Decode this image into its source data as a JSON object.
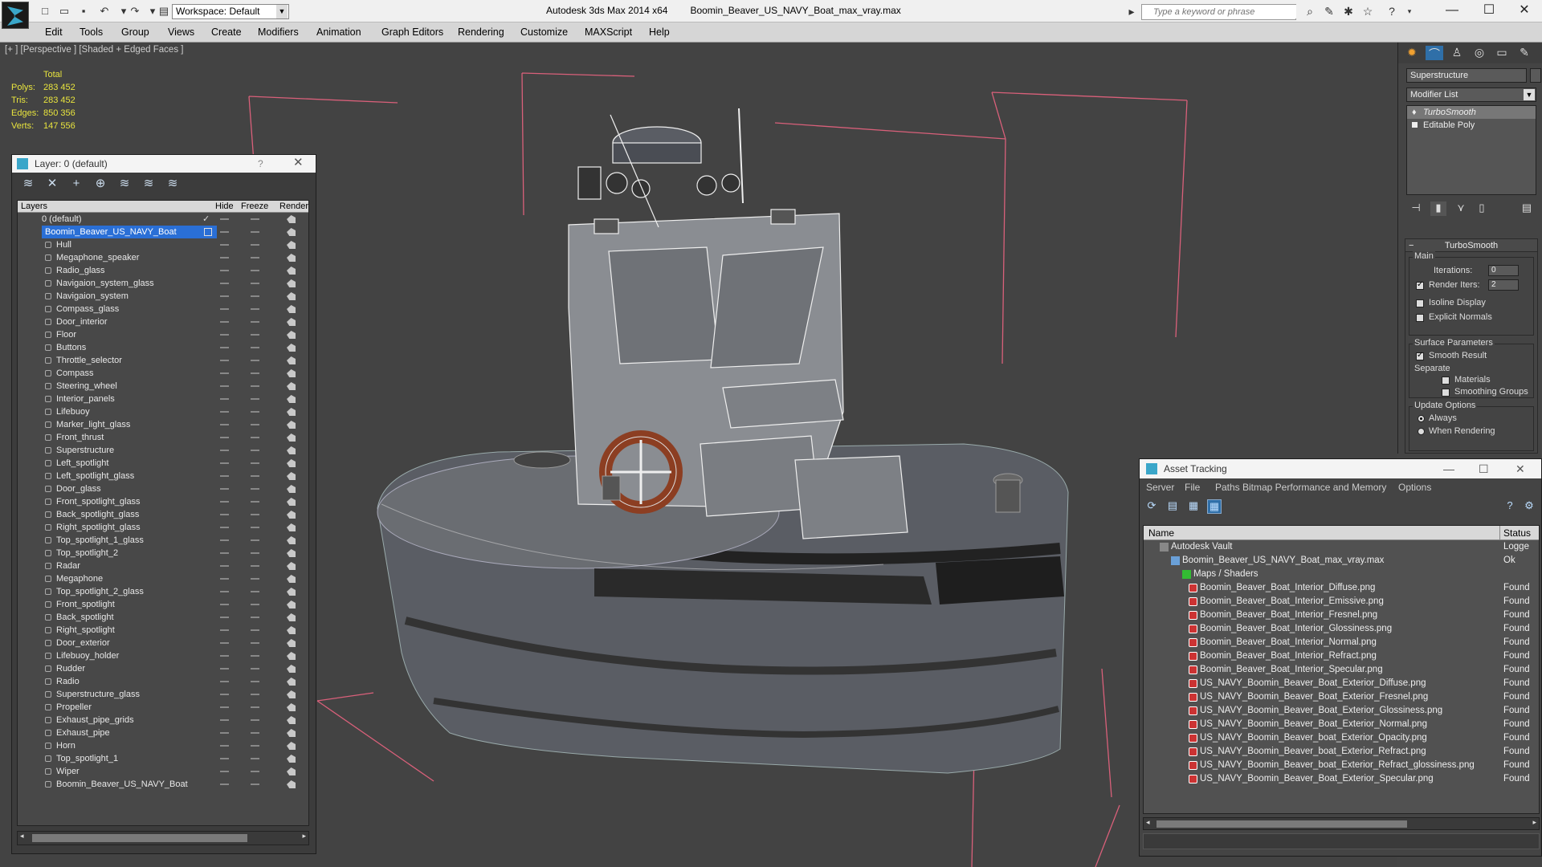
{
  "titlebar": {
    "workspace_label": "Workspace: Default",
    "app_name": "Autodesk 3ds Max  2014 x64",
    "file_name": "Boomin_Beaver_US_NAVY_Boat_max_vray.max",
    "search_placeholder": "Type a keyword or phrase"
  },
  "menu": [
    "Edit",
    "Tools",
    "Group",
    "Views",
    "Create",
    "Modifiers",
    "Animation",
    "Graph Editors",
    "Rendering",
    "Customize",
    "MAXScript",
    "Help"
  ],
  "viewport": {
    "label": "[+ ] [Perspective ] [Shaded + Edged Faces ]",
    "stats_header": "Total",
    "stats": [
      {
        "k": "Polys:",
        "v": "283 452"
      },
      {
        "k": "Tris:",
        "v": "283 452"
      },
      {
        "k": "Edges:",
        "v": "850 356"
      },
      {
        "k": "Verts:",
        "v": "147 556"
      }
    ]
  },
  "layer_panel": {
    "title": "Layer: 0 (default)",
    "help": "?",
    "col_layers": "Layers",
    "col_hide": "Hide",
    "col_freeze": "Freeze",
    "col_render": "Render",
    "default_layer": "0 (default)",
    "boat_layer": "Boomin_Beaver_US_NAVY_Boat",
    "objects": [
      "Hull",
      "Megaphone_speaker",
      "Radio_glass",
      "Navigaion_system_glass",
      "Navigaion_system",
      "Compass_glass",
      "Door_interior",
      "Floor",
      "Buttons",
      "Throttle_selector",
      "Compass",
      "Steering_wheel",
      "Interior_panels",
      "Lifebuoy",
      "Marker_light_glass",
      "Front_thrust",
      "Superstructure",
      "Left_spotlight",
      "Left_spotlight_glass",
      "Door_glass",
      "Front_spotlight_glass",
      "Back_spotlight_glass",
      "Right_spotlight_glass",
      "Top_spotlight_1_glass",
      "Top_spotlight_2",
      "Radar",
      "Megaphone",
      "Top_spotlight_2_glass",
      "Front_spotlight",
      "Back_spotlight",
      "Right_spotlight",
      "Door_exterior",
      "Lifebuoy_holder",
      "Rudder",
      "Radio",
      "Superstructure_glass",
      "Propeller",
      "Exhaust_pipe_grids",
      "Exhaust_pipe",
      "Horn",
      "Top_spotlight_1",
      "Wiper",
      "Boomin_Beaver_US_NAVY_Boat"
    ]
  },
  "command_panel": {
    "object_name": "Superstructure",
    "modifier_list": "Modifier List",
    "stack": [
      "TurboSmooth",
      "Editable Poly"
    ],
    "rollout_title": "TurboSmooth",
    "main_label": "Main",
    "iterations_label": "Iterations:",
    "iterations_value": "0",
    "render_iters_label": "Render Iters:",
    "render_iters_value": "2",
    "isoline": "Isoline Display",
    "explicit": "Explicit Normals",
    "surface_params": "Surface Parameters",
    "smooth_result": "Smooth Result",
    "separate": "Separate",
    "materials": "Materials",
    "smoothing_groups": "Smoothing Groups",
    "update_options": "Update Options",
    "always": "Always",
    "when_rendering": "When Rendering"
  },
  "asset_tracking": {
    "title": "Asset Tracking",
    "menu": [
      "Server",
      "File",
      "Paths",
      "Bitmap Performance and Memory",
      "Options"
    ],
    "col_name": "Name",
    "col_status": "Status",
    "vault": {
      "name": "Autodesk Vault",
      "status": "Logge"
    },
    "max_file": {
      "name": "Boomin_Beaver_US_NAVY_Boat_max_vray.max",
      "status": "Ok"
    },
    "maps_folder": "Maps / Shaders",
    "maps": [
      {
        "name": "Boomin_Beaver_Boat_Interior_Diffuse.png",
        "status": "Found"
      },
      {
        "name": "Boomin_Beaver_Boat_Interior_Emissive.png",
        "status": "Found"
      },
      {
        "name": "Boomin_Beaver_Boat_Interior_Fresnel.png",
        "status": "Found"
      },
      {
        "name": "Boomin_Beaver_Boat_Interior_Glossiness.png",
        "status": "Found"
      },
      {
        "name": "Boomin_Beaver_Boat_Interior_Normal.png",
        "status": "Found"
      },
      {
        "name": "Boomin_Beaver_Boat_Interior_Refract.png",
        "status": "Found"
      },
      {
        "name": "Boomin_Beaver_Boat_Interior_Specular.png",
        "status": "Found"
      },
      {
        "name": "US_NAVY_Boomin_Beaver_Boat_Exterior_Diffuse.png",
        "status": "Found"
      },
      {
        "name": "US_NAVY_Boomin_Beaver_Boat_Exterior_Fresnel.png",
        "status": "Found"
      },
      {
        "name": "US_NAVY_Boomin_Beaver_Boat_Exterior_Glossiness.png",
        "status": "Found"
      },
      {
        "name": "US_NAVY_Boomin_Beaver_Boat_Exterior_Normal.png",
        "status": "Found"
      },
      {
        "name": "US_NAVY_Boomin_Beaver_boat_Exterior_Opacity.png",
        "status": "Found"
      },
      {
        "name": "US_NAVY_Boomin_Beaver_boat_Exterior_Refract.png",
        "status": "Found"
      },
      {
        "name": "US_NAVY_Boomin_Beaver_boat_Exterior_Refract_glossiness.png",
        "status": "Found"
      },
      {
        "name": "US_NAVY_Boomin_Beaver_Boat_Exterior_Specular.png",
        "status": "Found"
      }
    ]
  }
}
